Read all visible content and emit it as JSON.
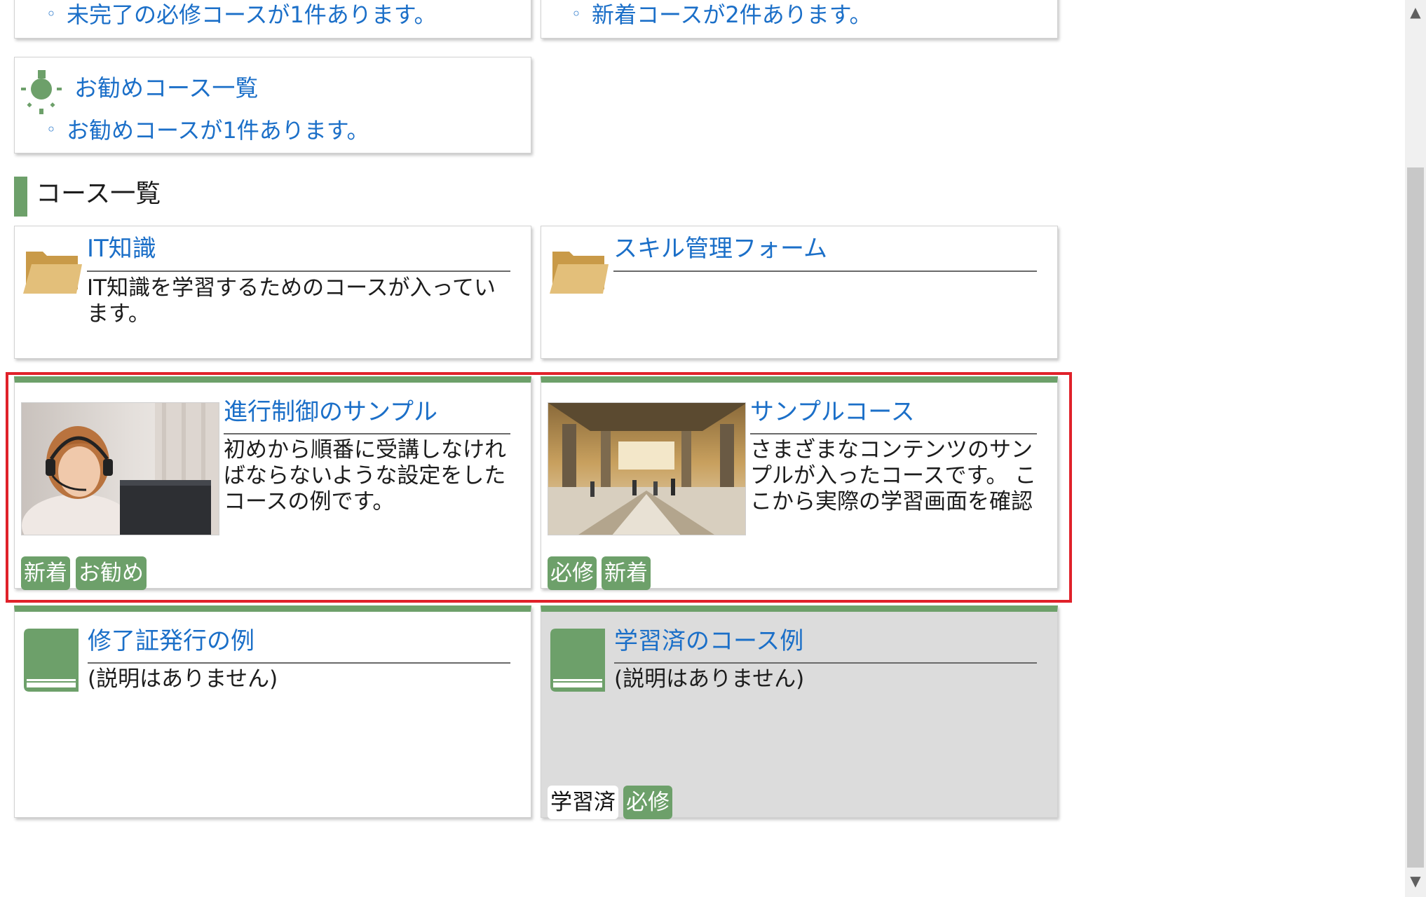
{
  "notices": {
    "required_unfinished": "未完了の必修コースが1件あります。",
    "new_courses": "新着コースが2件あります。",
    "recommended": {
      "title": "お勧めコース一覧",
      "text": "お勧めコースが1件あります。",
      "icon": "lightbulb-icon"
    },
    "bullet": "◦"
  },
  "section_title": "コース一覧",
  "folders": [
    {
      "title": "IT知識",
      "description": "IT知識を学習するためのコースが入っています。",
      "icon": "folder-icon"
    },
    {
      "title": "スキル管理フォーム",
      "description": "",
      "icon": "folder-icon"
    }
  ],
  "courses": [
    {
      "title": "進行制御のサンプル",
      "description": "初めから順番に受講しなければならないような設定をしたコースの例です。",
      "tags": [
        "新着",
        "お勧め"
      ],
      "thumbnail": "woman-headset-photo"
    },
    {
      "title": "サンプルコース",
      "description": "さまざまなコンテンツのサンプルが入ったコースです。 ここから実際の学習画面を確認",
      "tags": [
        "必修",
        "新着"
      ],
      "thumbnail": "station-hall-photo"
    },
    {
      "title": "修了証発行の例",
      "description": "(説明はありません)",
      "tags": [],
      "icon": "book-icon"
    },
    {
      "title": "学習済のコース例",
      "description": "(説明はありません)",
      "tags": [
        "学習済",
        "必修"
      ],
      "icon": "book-icon",
      "completed": true
    }
  ],
  "colors": {
    "accent": "#6da06a",
    "link": "#1b6fc8",
    "highlight": "#e0212a",
    "completed_bg": "#dcdcdc"
  },
  "scrollbar": {
    "up": "▲",
    "down": "▼"
  }
}
